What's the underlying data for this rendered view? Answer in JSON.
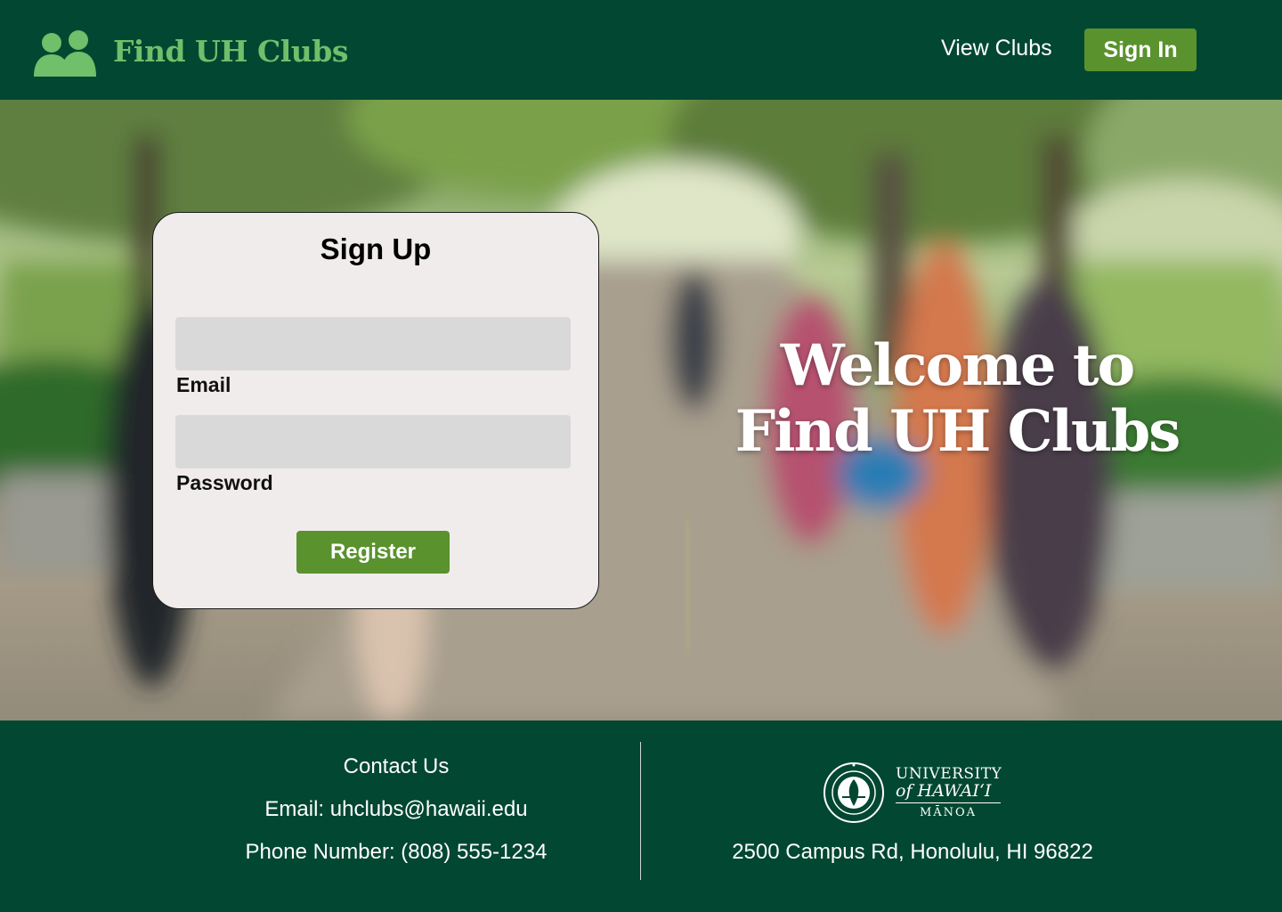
{
  "header": {
    "brand": "Find UH Clubs",
    "nav_view_clubs": "View Clubs",
    "sign_in_label": "Sign In",
    "logo_icon": "users-icon"
  },
  "hero": {
    "welcome_line1": "Welcome to",
    "welcome_line2": "Find UH Clubs",
    "background": "blurred-campus-photo"
  },
  "signup": {
    "title": "Sign Up",
    "email_label": "Email",
    "email_value": "",
    "password_label": "Password",
    "password_value": "",
    "register_label": "Register"
  },
  "footer": {
    "contact_title": "Contact Us",
    "email_line": "Email: uhclubs@hawaii.edu",
    "phone_line": "Phone Number: (808) 555-1234",
    "university_line1": "UNIVERSITY",
    "university_line2": "of HAWAI‘I",
    "university_line3": "MĀNOA",
    "address": "2500 Campus Rd, Honolulu, HI 96822"
  },
  "colors": {
    "primary_dark_green": "#024731",
    "accent_green": "#5a922e",
    "brand_text_green": "#6fbf6b",
    "card_bg": "#f1ecec",
    "field_bg": "#d9d9d9"
  }
}
